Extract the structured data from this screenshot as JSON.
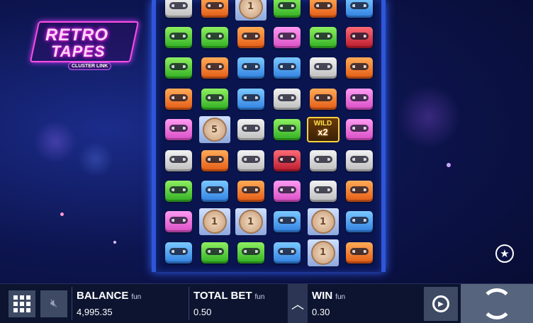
{
  "logo": {
    "line1": "RETRO",
    "line2": "TAPES",
    "sub": "CLUSTER LINK"
  },
  "colors": {
    "white": "#d8d8d8",
    "green": "#4fcf3a",
    "orange": "#f07a2a",
    "pink": "#f070de",
    "blue": "#4ea4f0",
    "red": "#d83040"
  },
  "reels": [
    [
      "white",
      "orange",
      "coin:1",
      "green",
      "orange",
      "blue"
    ],
    [
      "green",
      "green",
      "orange",
      "pink",
      "green",
      "red"
    ],
    [
      "green",
      "orange",
      "blue",
      "blue",
      "white",
      "orange"
    ],
    [
      "orange",
      "green",
      "blue",
      "white",
      "orange",
      "pink"
    ],
    [
      "pink",
      "coin:5",
      "white",
      "green",
      "wild",
      "pink"
    ],
    [
      "white",
      "orange",
      "white",
      "red",
      "white",
      "white"
    ],
    [
      "green",
      "blue",
      "orange",
      "pink",
      "white",
      "orange"
    ],
    [
      "pink",
      "coin:1",
      "coin:1",
      "blue",
      "coin:1",
      "blue"
    ],
    [
      "blue",
      "green",
      "green",
      "blue",
      "coin:1",
      "orange"
    ]
  ],
  "wild": {
    "label": "WILD",
    "multiplier": "x2"
  },
  "favorite_icon": "star-icon",
  "bottom_bar": {
    "balance": {
      "label": "BALANCE",
      "unit": "fun",
      "value": "4,995.35"
    },
    "total_bet": {
      "label": "TOTAL BET",
      "unit": "fun",
      "value": "0.50"
    },
    "win": {
      "label": "WIN",
      "unit": "fun",
      "value": "0.30"
    },
    "up_icon": "chevron-up-icon",
    "menu_icon": "grid-menu-icon",
    "mute_icon": "speaker-muted-icon",
    "autoplay_icon": "autoplay-icon",
    "spin_icon": "spin-icon"
  }
}
